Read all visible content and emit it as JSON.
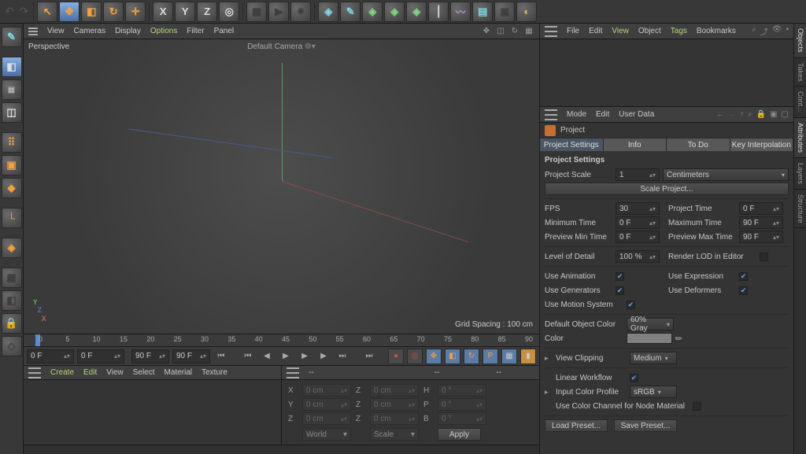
{
  "top_toolbar": {
    "move": "✥",
    "scale": "◧",
    "rotate": "↻",
    "place": "✛",
    "x": "X",
    "y": "Y",
    "z": "Z",
    "lock": "◎",
    "film": "▦",
    "play": "▶",
    "gear": "✷",
    "cube": "◈",
    "pen": "✎",
    "subd": "◈",
    "clone": "◈",
    "poly": "◈",
    "bool": "⎮",
    "bend": "〰",
    "floor": "▤",
    "camera": "▣",
    "light": "◐"
  },
  "obj_menu": {
    "file": "File",
    "edit": "Edit",
    "view": "View",
    "object": "Object",
    "tags": "Tags",
    "bookmarks": "Bookmarks"
  },
  "attr_menu": {
    "mode": "Mode",
    "edit": "Edit",
    "userdata": "User Data"
  },
  "attr_header": {
    "project": "Project"
  },
  "tabs": {
    "settings": "Project Settings",
    "info": "Info",
    "todo": "To Do",
    "key": "Key Interpolation"
  },
  "settings": {
    "title": "Project Settings",
    "project_scale_label": "Project Scale",
    "project_scale_value": "1",
    "project_scale_unit": "Centimeters",
    "scale_btn": "Scale Project...",
    "fps_label": "FPS",
    "fps_value": "30",
    "project_time_label": "Project Time",
    "project_time_value": "0 F",
    "min_time_label": "Minimum Time",
    "min_time_value": "0 F",
    "max_time_label": "Maximum Time",
    "max_time_value": "90 F",
    "pmin_label": "Preview Min Time",
    "pmin_value": "0 F",
    "pmax_label": "Preview Max Time",
    "pmax_value": "90 F",
    "lod_label": "Level of Detail",
    "lod_value": "100 %",
    "render_lod_label": "Render LOD in Editor",
    "use_anim_label": "Use Animation",
    "use_expr_label": "Use Expression",
    "use_gen_label": "Use Generators",
    "use_def_label": "Use Deformers",
    "use_mot_label": "Use Motion System",
    "def_color_label": "Default Object Color",
    "def_color_value": "60% Gray",
    "color_label": "Color",
    "view_clip_label": "View Clipping",
    "view_clip_value": "Medium",
    "linear_wf_label": "Linear Workflow",
    "icp_label": "Input Color Profile",
    "icp_value": "sRGB",
    "use_cc_label": "Use Color Channel for Node Material",
    "load_preset": "Load Preset...",
    "save_preset": "Save Preset..."
  },
  "view_menu": {
    "view": "View",
    "cameras": "Cameras",
    "display": "Display",
    "options": "Options",
    "filter": "Filter",
    "panel": "Panel"
  },
  "viewport": {
    "persp": "Perspective",
    "camera": "Default Camera",
    "grid": "Grid Spacing : 100 cm"
  },
  "ruler_labels": [
    "0",
    "5",
    "10",
    "15",
    "20",
    "25",
    "30",
    "35",
    "40",
    "45",
    "50",
    "55",
    "60",
    "65",
    "70",
    "75",
    "80",
    "85",
    "90"
  ],
  "playbar": {
    "start": "0 F",
    "from": "0 F",
    "to": "90 F",
    "cursor": "90 F"
  },
  "asset_menu": {
    "create": "Create",
    "edit": "Edit",
    "view": "View",
    "select": "Select",
    "material": "Material",
    "texture": "Texture"
  },
  "coord": {
    "dashes": "--",
    "x": "X",
    "y": "Y",
    "z": "Z",
    "h": "H",
    "p": "P",
    "b": "B",
    "xval": "0 cm",
    "zero": "0",
    "deg": "0 °",
    "world": "World",
    "scale": "Scale",
    "apply": "Apply"
  },
  "right_tabs": {
    "objects": "Objects",
    "takes": "Takes",
    "cont": "Cont...",
    "attributes": "Attributes",
    "layers": "Layers",
    "structure": "Structure"
  }
}
